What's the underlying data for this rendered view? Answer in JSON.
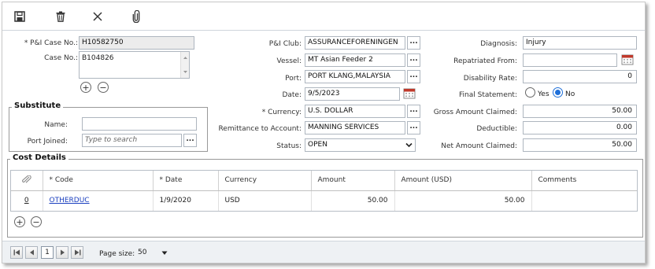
{
  "toolbar": {
    "icons": [
      "save-icon",
      "trash-icon",
      "close-icon",
      "paperclip-icon"
    ]
  },
  "left": {
    "pi_case_no_label": "* P&I Case No.:",
    "pi_case_no_value": "H10582750",
    "case_no_label": "Case No.:",
    "case_no_value": "B104826",
    "add_symbol": "+",
    "remove_symbol": "−"
  },
  "substitute": {
    "legend": "Substitute",
    "name_label": "Name:",
    "name_value": "",
    "port_joined_label": "Port Joined:",
    "port_joined_placeholder": "Type to search",
    "lookup_label": "..."
  },
  "middle": {
    "pi_club_label": "P&I Club:",
    "pi_club_value": "ASSURANCEFORENINGEN",
    "vessel_label": "Vessel:",
    "vessel_value": "MT Asian Feeder 2",
    "port_label": "Port:",
    "port_value": "PORT KLANG,MALAYSIA",
    "date_label": "Date:",
    "date_value": "9/5/2023",
    "currency_label": "* Currency:",
    "currency_value": "U.S.  DOLLAR",
    "remittance_label": "Remittance to Account:",
    "remittance_value": "MANNING SERVICES",
    "status_label": "Status:",
    "status_value": "OPEN",
    "lookup_label": "..."
  },
  "right": {
    "diagnosis_label": "Diagnosis:",
    "diagnosis_value": "Injury",
    "repatriated_label": "Repatriated From:",
    "repatriated_value": "",
    "disability_label": "Disability Rate:",
    "disability_value": "0",
    "final_statement_label": "Final Statement:",
    "final_yes": "Yes",
    "final_no": "No",
    "final_selected": "No",
    "gross_label": "Gross Amount Claimed:",
    "gross_value": "50.00",
    "deductible_label": "Deductible:",
    "deductible_value": "0.00",
    "net_label": "Net Amount Claimed:",
    "net_value": "50.00"
  },
  "cost_details": {
    "legend": "Cost Details",
    "columns": [
      "* Code",
      "* Date",
      "Currency",
      "Amount",
      "Amount (USD)",
      "Comments"
    ],
    "rows": [
      {
        "index": "0",
        "code": "OTHERDUC",
        "date": "1/9/2020",
        "currency": "USD",
        "amount": "50.00",
        "amount_usd": "50.00",
        "comments": ""
      }
    ]
  },
  "pager": {
    "current_page": "1",
    "page_size_label": "Page size:",
    "page_size_value": "50"
  },
  "colors": {
    "link": "#1a3fbf",
    "radio_selected": "#1e6fd9",
    "calendar_accent": "#c0392b"
  }
}
